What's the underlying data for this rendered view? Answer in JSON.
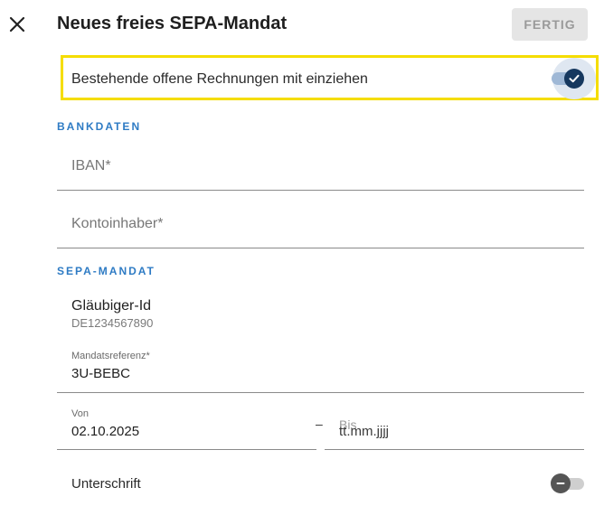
{
  "header": {
    "title": "Neues freies SEPA-Mandat",
    "done_label": "FERTIG"
  },
  "collect_invoices": {
    "label": "Bestehende offene Rechnungen mit einziehen",
    "checked": true
  },
  "bank_section": {
    "title": "BANKDATEN",
    "iban_placeholder": "IBAN*",
    "holder_placeholder": "Kontoinhaber*"
  },
  "mandate_section": {
    "title": "SEPA-MANDAT",
    "creditor_label": "Gläubiger-Id",
    "creditor_value": "DE1234567890",
    "reference_label": "Mandatsreferenz*",
    "reference_value": "3U-BEBC",
    "from_label": "Von",
    "from_value": "02.10.2025",
    "dash": "–",
    "to_label": "Bis",
    "to_placeholder": "tt.mm.jjjj",
    "signature_label": "Unterschrift",
    "signature_checked": false
  },
  "colors": {
    "accent": "#2e7bc4",
    "toggle_on": "#16385f",
    "highlight": "#f5dd00"
  }
}
